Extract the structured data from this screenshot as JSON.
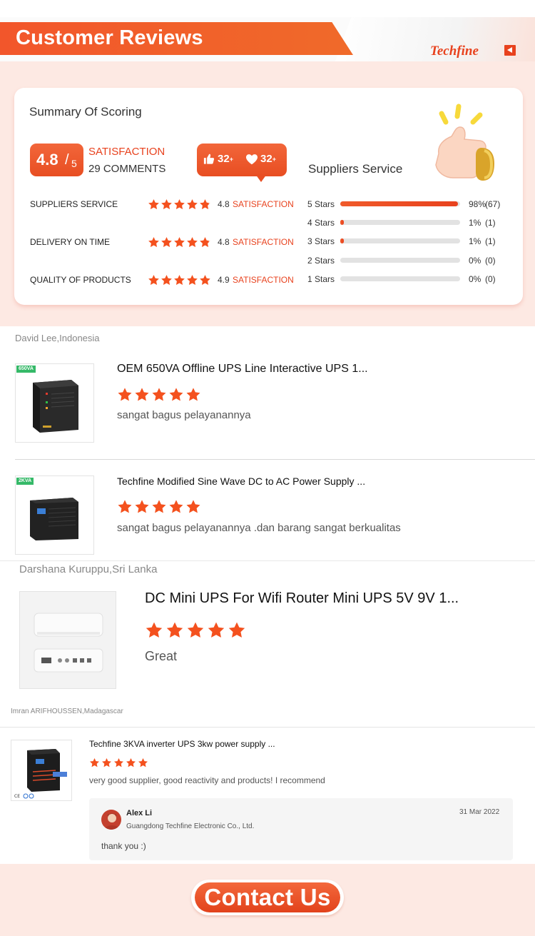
{
  "header": {
    "title": "Customer Reviews",
    "brand": "Techfine"
  },
  "summary": {
    "title": "Summary Of Scoring",
    "score": "4.8",
    "score_max": "5",
    "satisfaction_label": "SATISFACTION",
    "comments": "29 COMMENTS",
    "likes": "32",
    "likes_sup": "+",
    "hearts": "32",
    "hearts_sup": "+",
    "metrics": [
      {
        "label": "SUPPLIERS SERVICE",
        "value": "4.8",
        "rating": 4.8,
        "unit": "SATISFACTION"
      },
      {
        "label": "DELIVERY ON TIME",
        "value": "4.8",
        "rating": 4.8,
        "unit": "SATISFACTION"
      },
      {
        "label": "QUALITY OF PRODUCTS",
        "value": "4.9",
        "rating": 4.9,
        "unit": "SATISFACTION"
      }
    ],
    "service_title": "Suppliers Service",
    "distribution": [
      {
        "label": "5  Stars",
        "percent": "98%",
        "count": "(67)",
        "fraction": 0.98
      },
      {
        "label": "4  Stars",
        "percent": "1%",
        "count": "(1)",
        "fraction": 0.03
      },
      {
        "label": "3  Stars",
        "percent": "1%",
        "count": "(1)",
        "fraction": 0.03
      },
      {
        "label": "2  Stars",
        "percent": "0%",
        "count": "(0)",
        "fraction": 0
      },
      {
        "label": "1  Stars",
        "percent": "0%",
        "count": "(0)",
        "fraction": 0
      }
    ]
  },
  "reviews": [
    {
      "reviewer": "David Lee,Indonesia",
      "items": [
        {
          "tag": "650VA",
          "title": "OEM 650VA Offline UPS Line Interactive UPS 1...",
          "stars": 5,
          "text": "sangat bagus pelayanannya"
        },
        {
          "tag": "2KVA",
          "title": "Techfine Modified Sine Wave DC to AC Power Supply ...",
          "stars": 5,
          "text": "sangat bagus pelayanannya .dan barang sangat berkualitas"
        }
      ]
    },
    {
      "reviewer": "Darshana Kuruppu,Sri Lanka",
      "items": [
        {
          "title": "DC Mini UPS For Wifi Router Mini UPS 5V 9V 1...",
          "stars": 5,
          "text": "Great"
        }
      ]
    },
    {
      "reviewer": "Imran ARIFHOUSSEN,Madagascar",
      "items": [
        {
          "title": "Techfine 3KVA inverter UPS 3kw power supply ...",
          "stars": 5,
          "text": "very good supplier, good reactivity and products! I recommend"
        }
      ],
      "reply": {
        "name": "Alex Li",
        "company": "Guangdong Techfine Electronic Co., Ltd.",
        "date": "31 Mar 2022",
        "text": "thank you :)"
      }
    }
  ],
  "footer": {
    "contact_label": "Contact Us"
  },
  "colors": {
    "accent": "#e8421e",
    "pink_bg": "#fde9e3",
    "star": "#f4511e"
  }
}
